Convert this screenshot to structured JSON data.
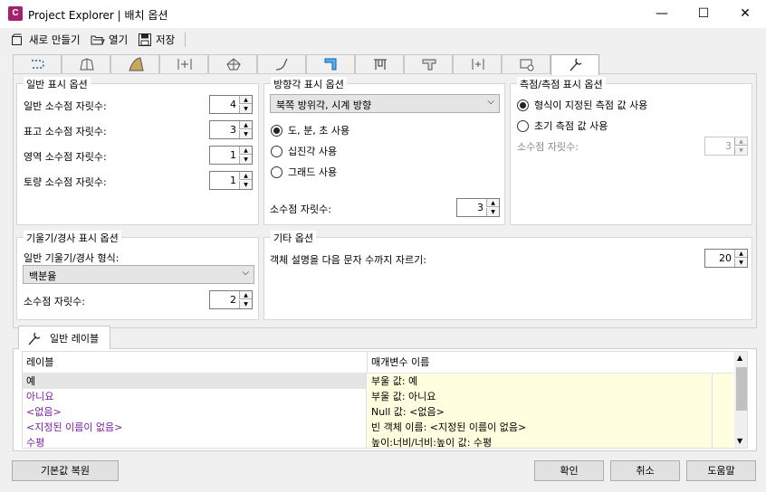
{
  "window": {
    "title": "Project Explorer | 배치 옵션",
    "app_icon_letter": "C",
    "minimize": "—",
    "maximize": "☐",
    "close": "✕"
  },
  "toolbar": {
    "new_label": "새로 만들기",
    "open_label": "열기",
    "save_label": "저장"
  },
  "icon_tabs": [
    "linework-tab",
    "profile-tab",
    "alignment-tab",
    "assembly-tab",
    "surface-tab",
    "corridor-tab",
    "pipe-tab",
    "structure-tab",
    "pressure-tab",
    "section-tab",
    "station-tab",
    "settings-tab"
  ],
  "general": {
    "title": "일반 표시 옵션",
    "rows": [
      {
        "label": "일반 소수점 자릿수:",
        "value": "4"
      },
      {
        "label": "표고 소수점 자릿수:",
        "value": "3"
      },
      {
        "label": "영역 소수점 자릿수:",
        "value": "1"
      },
      {
        "label": "토량 소수점 자릿수:",
        "value": "1"
      }
    ]
  },
  "bearing": {
    "title": "방향각 표시 옵션",
    "format": "북쪽 방위각, 시계 방향",
    "options": [
      "도, 분, 초 사용",
      "십진각 사용",
      "그래드 사용"
    ],
    "selected": 0,
    "decimal_label": "소수점 자릿수:",
    "decimal_value": "3"
  },
  "survey": {
    "title": "측점/측점 표시 옵션",
    "options": [
      "형식이 지정된 측점 값 사용",
      "초기 측점 값 사용"
    ],
    "selected": 0,
    "decimal_label": "소수점 자릿수:",
    "decimal_value": "3"
  },
  "grade": {
    "title": "기울기/경사 표시 옵션",
    "format_label": "일반 기울기/경사 형식:",
    "format_value": "백분율",
    "decimal_label": "소수점 자릿수:",
    "decimal_value": "2"
  },
  "other": {
    "title": "기타 옵션",
    "truncate_label": "객체 설명을 다음 문자 수까지 자르기:",
    "truncate_value": "20"
  },
  "labels_tab": {
    "title": "일반 레이블",
    "col1": "레이블",
    "col2": "매개변수 이름",
    "rows": [
      {
        "label": "예",
        "param": "부울 값: 예"
      },
      {
        "label": "아니요",
        "param": "부울 값: 아니요"
      },
      {
        "label": "<없음>",
        "param": "Null 값: <없음>"
      },
      {
        "label": "<지정된 이름이 없음>",
        "param": "빈 객체 이름: <지정된 이름이 없음>"
      },
      {
        "label": "수평",
        "param": "높이:너비/너비:높이 값: 수평"
      }
    ]
  },
  "buttons": {
    "reset": "기본값 복원",
    "ok": "확인",
    "cancel": "취소",
    "help": "도움말"
  },
  "colors": {
    "accent": "#a3216f",
    "label_purple": "#7a1fa2",
    "param_bg": "#ffffe0"
  }
}
